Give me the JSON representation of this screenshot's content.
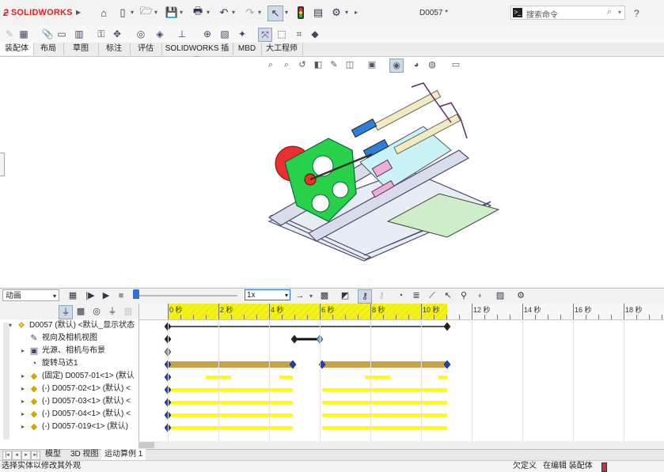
{
  "app": {
    "brand": "SOLIDWORKS",
    "doc_title": "D0057 *"
  },
  "search": {
    "placeholder": "搜索命令",
    "term_icon": "terminal-icon"
  },
  "tabs": [
    "装配体",
    "布局",
    "草图",
    "标注",
    "评估",
    "SOLIDWORKS 插件",
    "MBD",
    "大工程师"
  ],
  "motion": {
    "study_type": "动画",
    "speed": "1x"
  },
  "timeline": {
    "ticks": [
      "0 秒",
      "2 秒",
      "4 秒",
      "6 秒",
      "8 秒",
      "10 秒",
      "12 秒",
      "14 秒",
      "16 秒",
      "18 秒"
    ]
  },
  "tree": {
    "items": [
      {
        "label": "D0057 (默认) <默认_显示状态",
        "icon": "assembly-icon",
        "expand": "▾"
      },
      {
        "label": "视向及相机视图",
        "icon": "camera-view-icon",
        "expand": ""
      },
      {
        "label": "光源、相机与布景",
        "icon": "lights-icon",
        "expand": "▸"
      },
      {
        "label": "旋转马达1",
        "icon": "rotary-motor-icon",
        "expand": ""
      },
      {
        "label": "(固定) D0057-01<1> (默认",
        "icon": "part-icon",
        "expand": "▸"
      },
      {
        "label": "(-) D0057-02<1> (默认) <",
        "icon": "part-icon",
        "expand": "▸"
      },
      {
        "label": "(-) D0057-03<1> (默认) <",
        "icon": "part-icon",
        "expand": "▸"
      },
      {
        "label": "(-) D0057-04<1> (默认) <",
        "icon": "part-icon",
        "expand": "▸"
      },
      {
        "label": "(-) D0057-019<1> (默认)",
        "icon": "part-icon",
        "expand": "▸"
      }
    ]
  },
  "bottom_tabs": [
    "模型",
    "3D 视图",
    "运动算例 1"
  ],
  "status": {
    "hint": "选择实体以修改其外观",
    "undefined": "欠定义",
    "mode": "在编辑 装配体"
  },
  "colors": {
    "accent": "#2f6fd8",
    "brand": "#d22222",
    "key_bar": "#c8a24a",
    "yellow_bar": "#ffff00"
  }
}
